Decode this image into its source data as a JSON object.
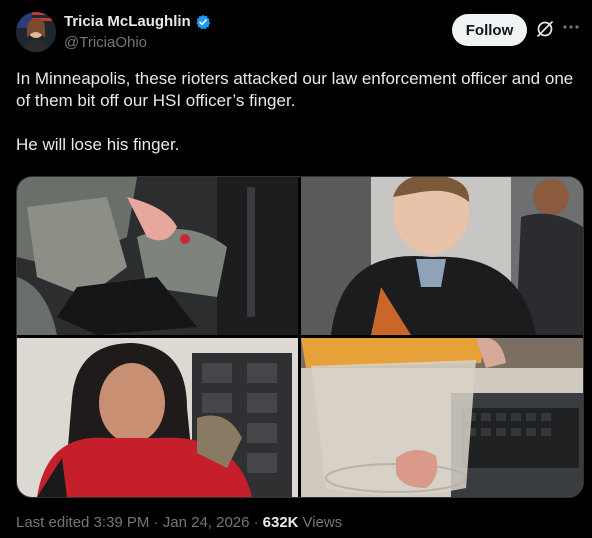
{
  "author": {
    "name": "Tricia McLaughlin",
    "handle": "@TriciaOhio",
    "verified": true
  },
  "actions": {
    "follow_label": "Follow"
  },
  "post": {
    "text": "In Minneapolis, these rioters attacked our law enforcement officer and one of them bit off our HSI officer’s finger.\n\nHe will lose his finger."
  },
  "footer": {
    "edited": "Last edited 3:39 PM · Jan 24, 2026 ·",
    "views_count": "632K",
    "views_label": "Views"
  },
  "icons": {
    "verified": "verified-badge-icon",
    "grok": "grok-icon",
    "more": "more-icon"
  },
  "colors": {
    "background": "#000000",
    "verified": "#1d9bf0",
    "follow_bg": "#eff3f4"
  }
}
